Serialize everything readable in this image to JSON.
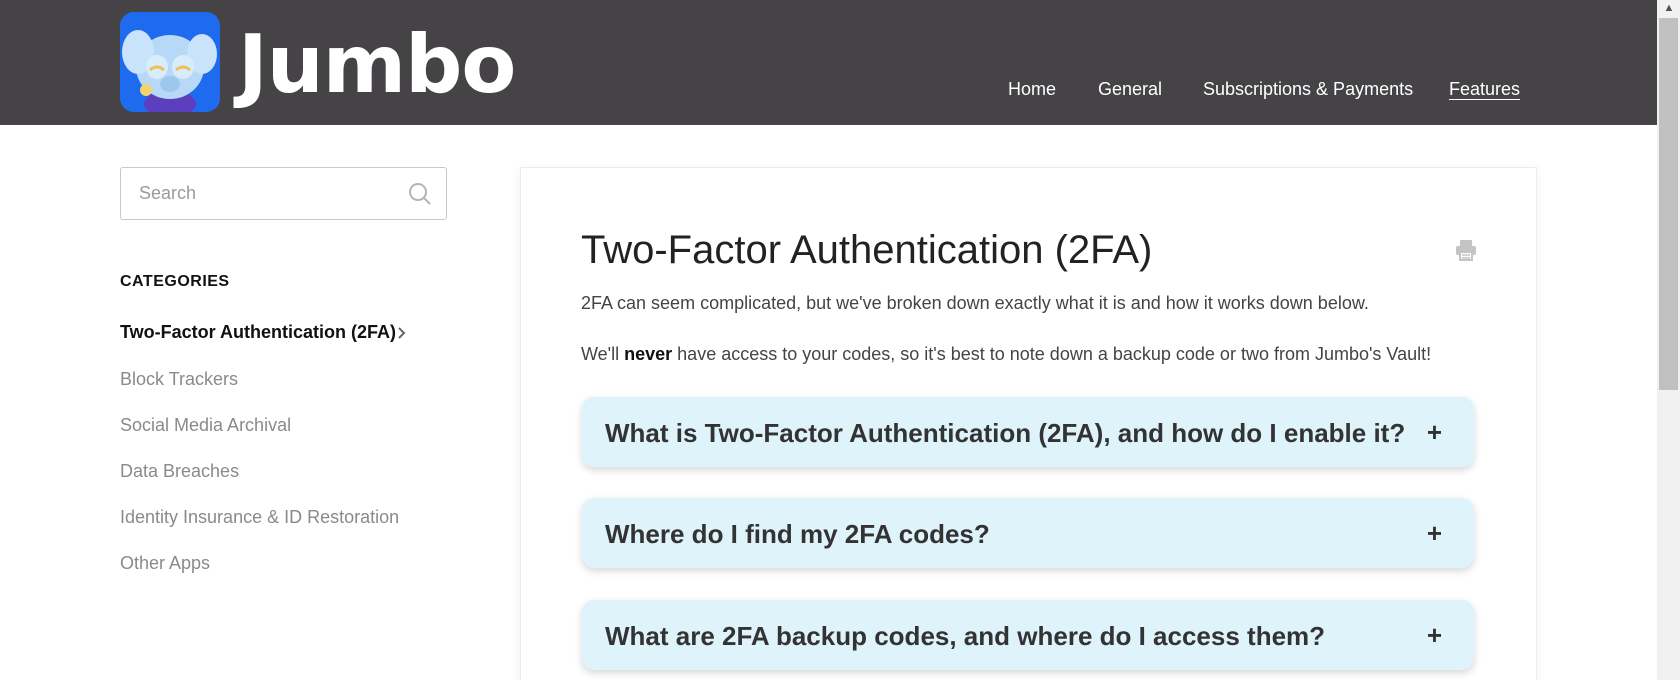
{
  "header": {
    "brand": "Jumbo",
    "nav": [
      {
        "label": "Home"
      },
      {
        "label": "General"
      },
      {
        "label": "Subscriptions & Payments"
      },
      {
        "label": "Features",
        "active": true
      }
    ],
    "background_color": "#454346"
  },
  "sidebar": {
    "search_placeholder": "Search",
    "categories_title": "CATEGORIES",
    "categories": [
      {
        "label": "Two-Factor Authentication (2FA)",
        "active": true
      },
      {
        "label": "Block Trackers"
      },
      {
        "label": "Social Media Archival"
      },
      {
        "label": "Data Breaches"
      },
      {
        "label": "Identity Insurance & ID Restoration"
      },
      {
        "label": "Other Apps"
      }
    ]
  },
  "article": {
    "title": "Two-Factor Authentication (2FA)",
    "intro": "2FA can seem complicated, but we've broken down exactly what it is and how it works down below.",
    "note_before": "We'll ",
    "note_bold": "never",
    "note_after": " have access to your codes, so it's best to note down a backup code or two from Jumbo's Vault!",
    "faqs": [
      {
        "question": "What is Two-Factor Authentication (2FA), and how do I enable it?",
        "toggle": "+"
      },
      {
        "question": "Where do I find my 2FA codes?",
        "toggle": "+"
      },
      {
        "question": "What are 2FA backup codes, and where do I access them?",
        "toggle": "+"
      }
    ],
    "accordion_color": "#dff3fb"
  }
}
